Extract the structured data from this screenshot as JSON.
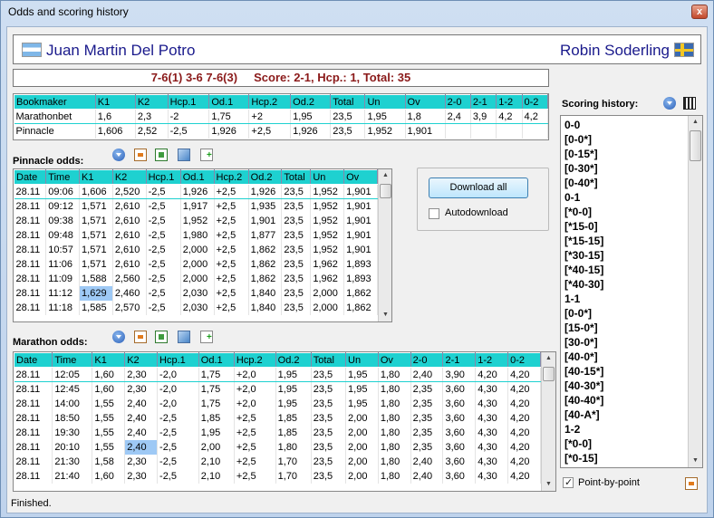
{
  "window": {
    "title": "Odds and scoring history",
    "close": "x"
  },
  "players": {
    "left": "Juan Martin Del Potro",
    "right": "Robin Soderling"
  },
  "score_line": "7-6(1) 3-6 7-6(3)     Score: 2-1, Hcp.: 1, Total: 35",
  "top_table": {
    "columns": [
      "Bookmaker",
      "K1",
      "K2",
      "Hcp.1",
      "Od.1",
      "Hcp.2",
      "Od.2",
      "Total",
      "Un",
      "Ov",
      "2-0",
      "2-1",
      "1-2",
      "0-2"
    ],
    "rows": [
      [
        "Marathonbet",
        "1,6",
        "2,3",
        "-2",
        "1,75",
        "+2",
        "1,95",
        "23,5",
        "1,95",
        "1,8",
        "2,4",
        "3,9",
        "4,2",
        "4,2"
      ],
      [
        "Pinnacle",
        "1,606",
        "2,52",
        "-2,5",
        "1,926",
        "+2,5",
        "1,926",
        "23,5",
        "1,952",
        "1,901",
        "",
        "",
        "",
        ""
      ]
    ]
  },
  "pinnacle": {
    "label": "Pinnacle odds:",
    "columns": [
      "Date",
      "Time",
      "K1",
      "K2",
      "Hcp.1",
      "Od.1",
      "Hcp.2",
      "Od.2",
      "Total",
      "Un",
      "Ov"
    ],
    "rows": [
      [
        "28.11",
        "09:06",
        "1,606",
        "2,520",
        "-2,5",
        "1,926",
        "+2,5",
        "1,926",
        "23,5",
        "1,952",
        "1,901"
      ],
      [
        "28.11",
        "09:12",
        "1,571",
        "2,610",
        "-2,5",
        "1,917",
        "+2,5",
        "1,935",
        "23,5",
        "1,952",
        "1,901"
      ],
      [
        "28.11",
        "09:38",
        "1,571",
        "2,610",
        "-2,5",
        "1,952",
        "+2,5",
        "1,901",
        "23,5",
        "1,952",
        "1,901"
      ],
      [
        "28.11",
        "09:48",
        "1,571",
        "2,610",
        "-2,5",
        "1,980",
        "+2,5",
        "1,877",
        "23,5",
        "1,952",
        "1,901"
      ],
      [
        "28.11",
        "10:57",
        "1,571",
        "2,610",
        "-2,5",
        "2,000",
        "+2,5",
        "1,862",
        "23,5",
        "1,952",
        "1,901"
      ],
      [
        "28.11",
        "11:06",
        "1,571",
        "2,610",
        "-2,5",
        "2,000",
        "+2,5",
        "1,862",
        "23,5",
        "1,962",
        "1,893"
      ],
      [
        "28.11",
        "11:09",
        "1,588",
        "2,560",
        "-2,5",
        "2,000",
        "+2,5",
        "1,862",
        "23,5",
        "1,962",
        "1,893"
      ],
      [
        "28.11",
        "11:12",
        "1,629",
        "2,460",
        "-2,5",
        "2,030",
        "+2,5",
        "1,840",
        "23,5",
        "2,000",
        "1,862"
      ],
      [
        "28.11",
        "11:18",
        "1,585",
        "2,570",
        "-2,5",
        "2,030",
        "+2,5",
        "1,840",
        "23,5",
        "2,000",
        "1,862"
      ]
    ]
  },
  "marathon": {
    "label": "Marathon odds:",
    "columns": [
      "Date",
      "Time",
      "K1",
      "K2",
      "Hcp.1",
      "Od.1",
      "Hcp.2",
      "Od.2",
      "Total",
      "Un",
      "Ov",
      "2-0",
      "2-1",
      "1-2",
      "0-2"
    ],
    "rows": [
      [
        "28.11",
        "12:05",
        "1,60",
        "2,30",
        "-2,0",
        "1,75",
        "+2,0",
        "1,95",
        "23,5",
        "1,95",
        "1,80",
        "2,40",
        "3,90",
        "4,20",
        "4,20"
      ],
      [
        "28.11",
        "12:45",
        "1,60",
        "2,30",
        "-2,0",
        "1,75",
        "+2,0",
        "1,95",
        "23,5",
        "1,95",
        "1,80",
        "2,35",
        "3,60",
        "4,30",
        "4,20"
      ],
      [
        "28.11",
        "14:00",
        "1,55",
        "2,40",
        "-2,0",
        "1,75",
        "+2,0",
        "1,95",
        "23,5",
        "1,95",
        "1,80",
        "2,35",
        "3,60",
        "4,30",
        "4,20"
      ],
      [
        "28.11",
        "18:50",
        "1,55",
        "2,40",
        "-2,5",
        "1,85",
        "+2,5",
        "1,85",
        "23,5",
        "2,00",
        "1,80",
        "2,35",
        "3,60",
        "4,30",
        "4,20"
      ],
      [
        "28.11",
        "19:30",
        "1,55",
        "2,40",
        "-2,5",
        "1,95",
        "+2,5",
        "1,85",
        "23,5",
        "2,00",
        "1,80",
        "2,35",
        "3,60",
        "4,30",
        "4,20"
      ],
      [
        "28.11",
        "20:10",
        "1,55",
        "2,40",
        "-2,5",
        "2,00",
        "+2,5",
        "1,80",
        "23,5",
        "2,00",
        "1,80",
        "2,35",
        "3,60",
        "4,30",
        "4,20"
      ],
      [
        "28.11",
        "21:30",
        "1,58",
        "2,30",
        "-2,5",
        "2,10",
        "+2,5",
        "1,70",
        "23,5",
        "2,00",
        "1,80",
        "2,40",
        "3,60",
        "4,30",
        "4,20"
      ],
      [
        "28.11",
        "21:40",
        "1,60",
        "2,30",
        "-2,5",
        "2,10",
        "+2,5",
        "1,70",
        "23,5",
        "2,00",
        "1,80",
        "2,40",
        "3,60",
        "4,30",
        "4,20"
      ]
    ]
  },
  "download": {
    "button": "Download all",
    "auto_label": "Autodownload",
    "auto_checked": false
  },
  "scoring": {
    "label": "Scoring history:",
    "items": [
      "0-0",
      "[0-0*]",
      "[0-15*]",
      "[0-30*]",
      "[0-40*]",
      "0-1",
      "[*0-0]",
      "[*15-0]",
      "[*15-15]",
      "[*30-15]",
      "[*40-15]",
      "[*40-30]",
      "1-1",
      "[0-0*]",
      "[15-0*]",
      "[30-0*]",
      "[40-0*]",
      "[40-15*]",
      "[40-30*]",
      "[40-40*]",
      "[40-A*]",
      "1-2",
      "[*0-0]",
      "[*0-15]"
    ],
    "point_by_point": "Point-by-point",
    "point_by_point_checked": true
  },
  "status": "Finished."
}
